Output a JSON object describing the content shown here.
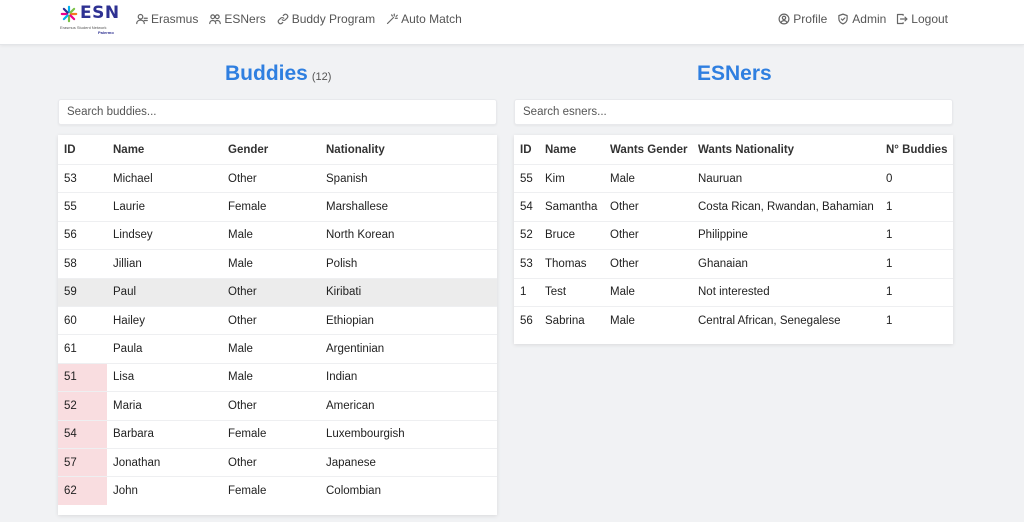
{
  "brand": {
    "name": "ESN",
    "subtitle": "Erasmus Student Network",
    "section": "Palermo"
  },
  "nav": {
    "left": [
      {
        "label": "Erasmus",
        "icon": "user-icon"
      },
      {
        "label": "ESNers",
        "icon": "users-icon"
      },
      {
        "label": "Buddy Program",
        "icon": "link-icon"
      },
      {
        "label": "Auto Match",
        "icon": "magic-wand-icon"
      }
    ],
    "right": [
      {
        "label": "Profile",
        "icon": "profile-circle-icon"
      },
      {
        "label": "Admin",
        "icon": "shield-icon"
      },
      {
        "label": "Logout",
        "icon": "logout-icon"
      }
    ]
  },
  "buddies": {
    "title": "Buddies",
    "count": "(12)",
    "search_placeholder": "Search buddies...",
    "columns": [
      "ID",
      "Name",
      "Gender",
      "Nationality"
    ],
    "rows": [
      {
        "id": "53",
        "name": "Michael",
        "gender": "Other",
        "nationality": "Spanish",
        "unmatched": false
      },
      {
        "id": "55",
        "name": "Laurie",
        "gender": "Female",
        "nationality": "Marshallese",
        "unmatched": false
      },
      {
        "id": "56",
        "name": "Lindsey",
        "gender": "Male",
        "nationality": "North Korean",
        "unmatched": false
      },
      {
        "id": "58",
        "name": "Jillian",
        "gender": "Male",
        "nationality": "Polish",
        "unmatched": false
      },
      {
        "id": "59",
        "name": "Paul",
        "gender": "Other",
        "nationality": "Kiribati",
        "unmatched": false,
        "selected": true
      },
      {
        "id": "60",
        "name": "Hailey",
        "gender": "Other",
        "nationality": "Ethiopian",
        "unmatched": false
      },
      {
        "id": "61",
        "name": "Paula",
        "gender": "Male",
        "nationality": "Argentinian",
        "unmatched": false
      },
      {
        "id": "51",
        "name": "Lisa",
        "gender": "Male",
        "nationality": "Indian",
        "unmatched": true
      },
      {
        "id": "52",
        "name": "Maria",
        "gender": "Other",
        "nationality": "American",
        "unmatched": true
      },
      {
        "id": "54",
        "name": "Barbara",
        "gender": "Female",
        "nationality": "Luxembourgish",
        "unmatched": true
      },
      {
        "id": "57",
        "name": "Jonathan",
        "gender": "Other",
        "nationality": "Japanese",
        "unmatched": true
      },
      {
        "id": "62",
        "name": "John",
        "gender": "Female",
        "nationality": "Colombian",
        "unmatched": true
      }
    ]
  },
  "esners": {
    "title": "ESNers",
    "search_placeholder": "Search esners...",
    "columns": [
      "ID",
      "Name",
      "Wants Gender",
      "Wants Nationality",
      "N° Buddies"
    ],
    "rows": [
      {
        "id": "55",
        "name": "Kim",
        "wants_gender": "Male",
        "wants_nationality": "Nauruan",
        "buddies": "0"
      },
      {
        "id": "54",
        "name": "Samantha",
        "wants_gender": "Other",
        "wants_nationality": "Costa Rican, Rwandan, Bahamian",
        "buddies": "1"
      },
      {
        "id": "52",
        "name": "Bruce",
        "wants_gender": "Other",
        "wants_nationality": "Philippine",
        "buddies": "1"
      },
      {
        "id": "53",
        "name": "Thomas",
        "wants_gender": "Other",
        "wants_nationality": "Ghanaian",
        "buddies": "1"
      },
      {
        "id": "1",
        "name": "Test",
        "wants_gender": "Male",
        "wants_nationality": "Not interested",
        "buddies": "1"
      },
      {
        "id": "56",
        "name": "Sabrina",
        "wants_gender": "Male",
        "wants_nationality": "Central African, Senegalese",
        "buddies": "1"
      }
    ]
  },
  "colors": {
    "accent": "#2f7fe0",
    "brand": "#2e3192",
    "unmatched_highlight": "#f9dde0",
    "selected_row": "#ececec"
  }
}
